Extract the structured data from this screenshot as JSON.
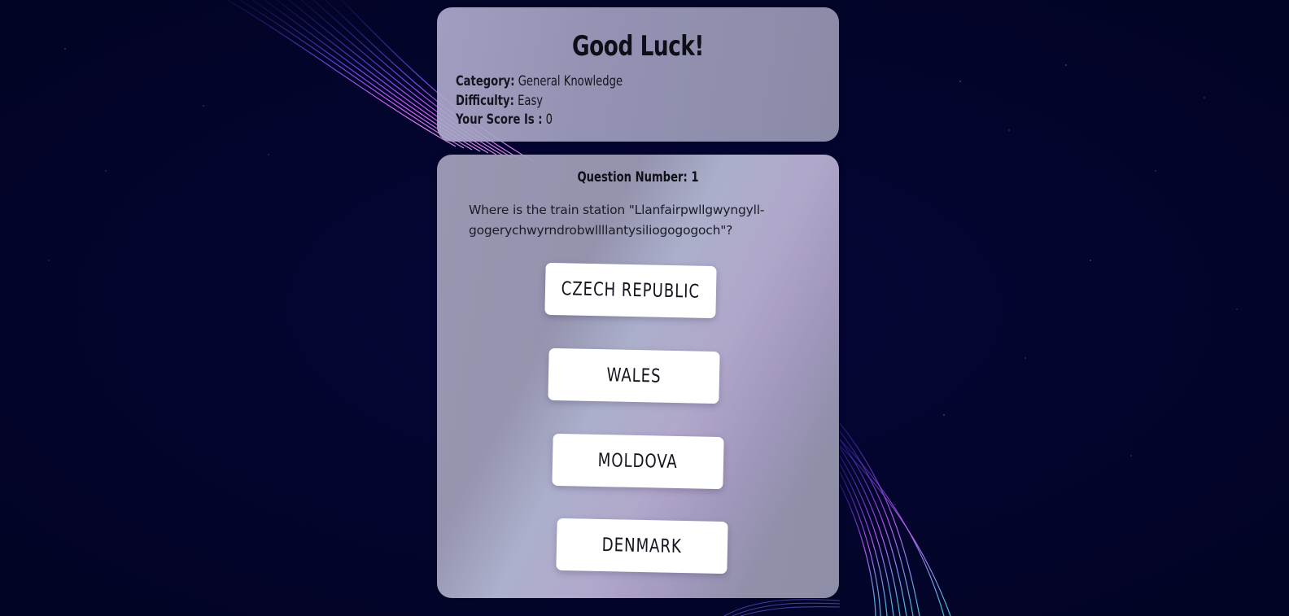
{
  "header": {
    "title": "Good Luck!",
    "category_label": "Category:",
    "category_value": "General Knowledge",
    "difficulty_label": "Difficulty:",
    "difficulty_value": "Easy",
    "score_label": "Your Score Is :",
    "score_value": "0"
  },
  "question": {
    "number_label": "Question Number: 1",
    "text": "Where is the train station \"Llanfairpwllgwyngyll-gogerychwyrndrobwllllantysiliogogogoch\"?",
    "answers": [
      "CZECH REPUBLIC",
      "WALES",
      "MOLDOVA",
      "DENMARK"
    ]
  },
  "colors": {
    "background": "#04052e",
    "card": "#9c9ab8",
    "button": "#ffffff",
    "text": "#15151f",
    "accent_pink": "#d35cf2",
    "accent_violet": "#7b4cf5"
  }
}
